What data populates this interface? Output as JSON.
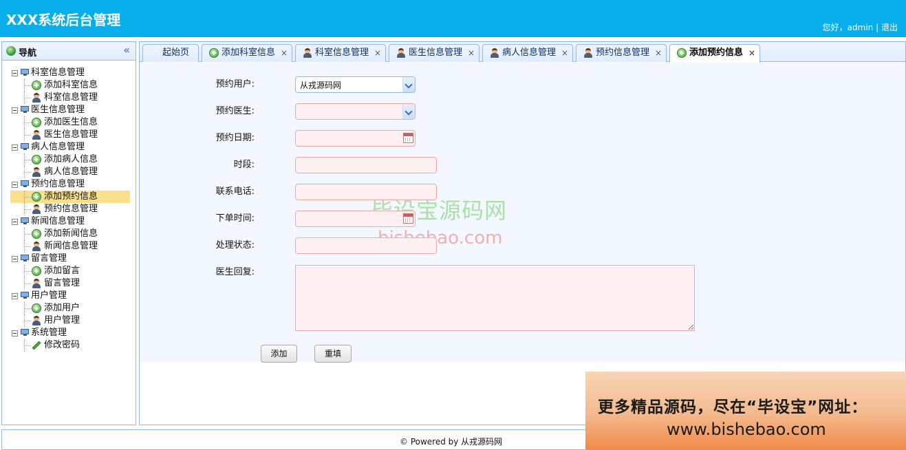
{
  "header": {
    "title": "XXX系统后台管理",
    "greeting": "您好，admin",
    "separator": "|",
    "logout": "退出"
  },
  "sidebar": {
    "title": "导航",
    "collapse": "«",
    "groups": [
      {
        "label": "科室信息管理",
        "children": [
          {
            "label": "添加科室信息",
            "icon": "add-icon"
          },
          {
            "label": "科室信息管理",
            "icon": "user-icon"
          }
        ]
      },
      {
        "label": "医生信息管理",
        "children": [
          {
            "label": "添加医生信息",
            "icon": "add-icon"
          },
          {
            "label": "医生信息管理",
            "icon": "user-icon"
          }
        ]
      },
      {
        "label": "病人信息管理",
        "children": [
          {
            "label": "添加病人信息",
            "icon": "add-icon"
          },
          {
            "label": "病人信息管理",
            "icon": "user-icon"
          }
        ]
      },
      {
        "label": "预约信息管理",
        "children": [
          {
            "label": "添加预约信息",
            "icon": "add-icon",
            "selected": true
          },
          {
            "label": "预约信息管理",
            "icon": "user-icon"
          }
        ]
      },
      {
        "label": "新闻信息管理",
        "children": [
          {
            "label": "添加新闻信息",
            "icon": "add-icon"
          },
          {
            "label": "新闻信息管理",
            "icon": "user-icon"
          }
        ]
      },
      {
        "label": "留言管理",
        "children": [
          {
            "label": "添加留言",
            "icon": "add-icon"
          },
          {
            "label": "留言管理",
            "icon": "user-icon"
          }
        ]
      },
      {
        "label": "用户管理",
        "children": [
          {
            "label": "添加用户",
            "icon": "add-icon"
          },
          {
            "label": "用户管理",
            "icon": "user-icon"
          }
        ]
      },
      {
        "label": "系统管理",
        "children": [
          {
            "label": "修改密码",
            "icon": "pencil-icon"
          }
        ]
      }
    ]
  },
  "tabs": [
    {
      "label": "起始页",
      "icon": "",
      "closable": false
    },
    {
      "label": "添加科室信息",
      "icon": "add-icon",
      "closable": true
    },
    {
      "label": "科室信息管理",
      "icon": "user-icon",
      "closable": true
    },
    {
      "label": "医生信息管理",
      "icon": "user-icon",
      "closable": true
    },
    {
      "label": "病人信息管理",
      "icon": "user-icon",
      "closable": true
    },
    {
      "label": "预约信息管理",
      "icon": "user-icon",
      "closable": true
    },
    {
      "label": "添加预约信息",
      "icon": "add-icon",
      "closable": true,
      "active": true
    }
  ],
  "tab_close": "×",
  "form": {
    "user_label": "预约用户:",
    "user_value": "从戎源码网",
    "doctor_label": "预约医生:",
    "doctor_value": "",
    "date_label": "预约日期:",
    "date_value": "",
    "period_label": "时段:",
    "period_value": "",
    "phone_label": "联系电话:",
    "phone_value": "",
    "order_time_label": "下单时间:",
    "order_time_value": "",
    "status_label": "处理状态:",
    "status_value": "",
    "reply_label": "医生回复:",
    "reply_value": "",
    "add_button": "添加",
    "reset_button": "重填"
  },
  "watermark": {
    "cn": "毕设宝源码网",
    "en": "bishebao.com"
  },
  "footer": {
    "text": "© Powered by 从戎源码网"
  },
  "ad": {
    "line1": "更多精品源码，尽在“毕设宝”网址：",
    "line2": "www.bishebao.com"
  }
}
